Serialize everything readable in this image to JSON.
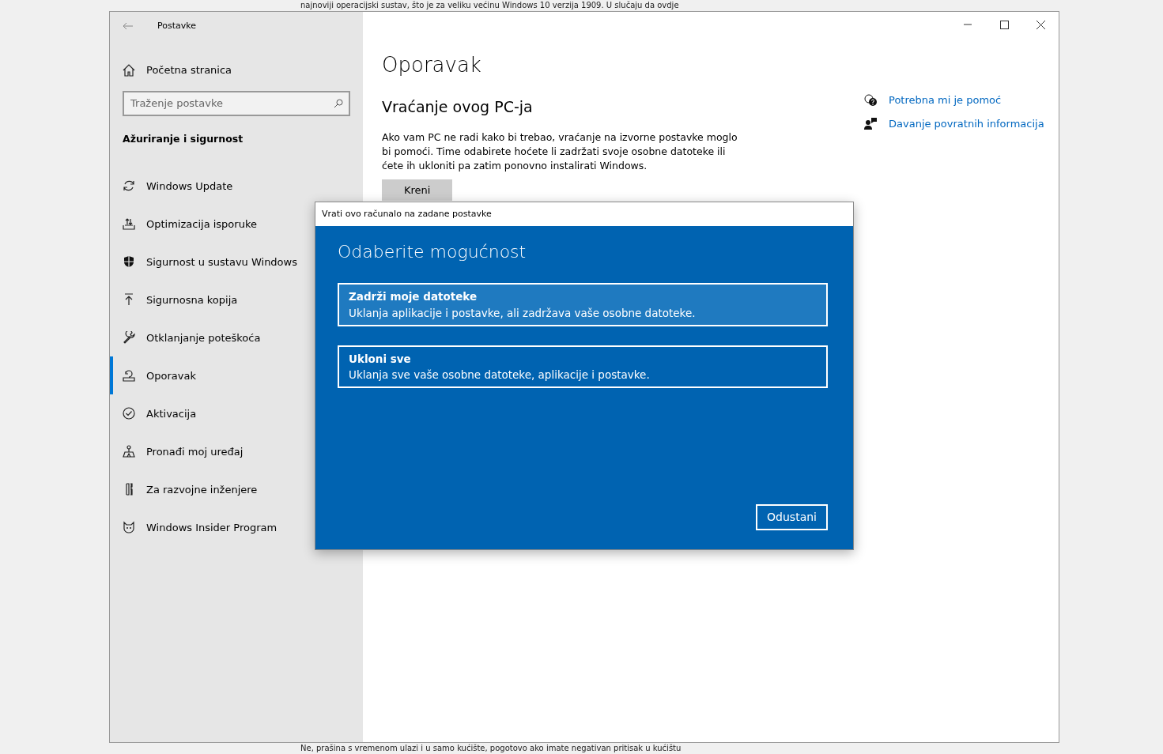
{
  "background_page": {
    "text_top": "najnoviji operacijski sustav, što je za veliku većinu Windows 10 verzija 1909. U slučaju da ovdje",
    "text_bottom": "Ne, prašina s vremenom ulazi i u samo kućište, pogotovo ako imate negativan pritisak u kućištu"
  },
  "window": {
    "title": "Postavke"
  },
  "sidebar": {
    "home": "Početna stranica",
    "search": {
      "placeholder": "Traženje postavke"
    },
    "section_title": "Ažuriranje i sigurnost",
    "items": [
      {
        "label": "Windows Update",
        "selected": false
      },
      {
        "label": "Optimizacija isporuke",
        "selected": false
      },
      {
        "label": "Sigurnost u sustavu Windows",
        "selected": false
      },
      {
        "label": "Sigurnosna kopija",
        "selected": false
      },
      {
        "label": "Otklanjanje poteškoća",
        "selected": false
      },
      {
        "label": "Oporavak",
        "selected": true
      },
      {
        "label": "Aktivacija",
        "selected": false
      },
      {
        "label": "Pronađi moj uređaj",
        "selected": false
      },
      {
        "label": "Za razvojne inženjere",
        "selected": false
      },
      {
        "label": "Windows Insider Program",
        "selected": false
      }
    ]
  },
  "main": {
    "title": "Oporavak",
    "section_title": "Vraćanje ovog PC-ja",
    "description": "Ako vam PC ne radi kako bi trebao, vraćanje na izvorne postavke moglo bi pomoći. Time odabirete hoćete li zadržati svoje osobne datoteke ili ćete ih ukloniti pa zatim ponovno instalirati Windows.",
    "button": "Kreni"
  },
  "help_links": [
    {
      "label": "Potrebna mi je pomoć"
    },
    {
      "label": "Davanje povratnih informacija"
    }
  ],
  "dialog": {
    "title": "Vrati ovo računalo na zadane postavke",
    "heading": "Odaberite mogućnost",
    "options": [
      {
        "title": "Zadrži moje datoteke",
        "description": "Uklanja aplikacije i postavke, ali zadržava vaše osobne datoteke.",
        "selected": true
      },
      {
        "title": "Ukloni sve",
        "description": "Uklanja sve vaše osobne datoteke, aplikacije i postavke.",
        "selected": false
      }
    ],
    "cancel": "Odustani"
  }
}
